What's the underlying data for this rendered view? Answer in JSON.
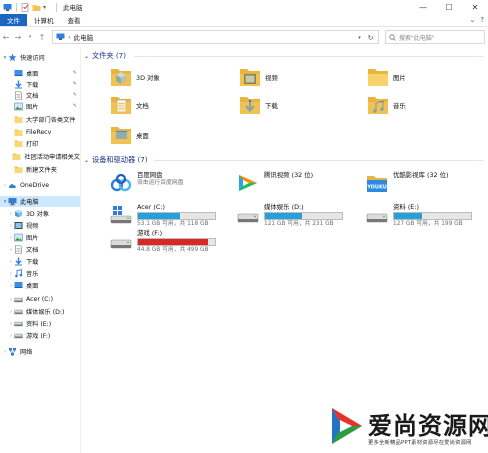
{
  "window": {
    "title": "此电脑",
    "controls": [
      "—",
      "☐",
      "✕"
    ]
  },
  "ribbon": {
    "tabs": [
      "文件",
      "计算机",
      "查看"
    ]
  },
  "address": {
    "crumb": "此电脑",
    "search_placeholder": "搜索\"此电脑\""
  },
  "sidebar": {
    "items": [
      {
        "label": "快速访问",
        "icon": "star-icon",
        "level": 0,
        "caret": "▾"
      },
      {
        "label": "桌面",
        "icon": "desktop-icon",
        "level": 1,
        "pin": true
      },
      {
        "label": "下载",
        "icon": "download-icon",
        "level": 1,
        "pin": true
      },
      {
        "label": "文档",
        "icon": "document-icon",
        "level": 1,
        "pin": true
      },
      {
        "label": "图片",
        "icon": "picture-icon",
        "level": 1,
        "pin": true
      },
      {
        "label": "大学部门各类文件",
        "icon": "folder-icon",
        "level": 1
      },
      {
        "label": "FileRecv",
        "icon": "folder-icon",
        "level": 1
      },
      {
        "label": "打印",
        "icon": "folder-icon",
        "level": 1
      },
      {
        "label": "社团活动申请相关文",
        "icon": "folder-icon",
        "level": 1
      },
      {
        "label": "新建文件夹",
        "icon": "folder-icon",
        "level": 1
      },
      {
        "label": "OneDrive",
        "icon": "cloud-icon",
        "level": 0,
        "caret": "›"
      },
      {
        "label": "此电脑",
        "icon": "computer-icon",
        "level": 0,
        "caret": "▾",
        "selected": true
      },
      {
        "label": "3D 对象",
        "icon": "cube-icon",
        "level": 1,
        "caret": "›"
      },
      {
        "label": "视频",
        "icon": "video-icon",
        "level": 1,
        "caret": "›"
      },
      {
        "label": "图片",
        "icon": "picture-icon",
        "level": 1,
        "caret": "›"
      },
      {
        "label": "文档",
        "icon": "document-icon",
        "level": 1,
        "caret": "›"
      },
      {
        "label": "下载",
        "icon": "download-icon",
        "level": 1,
        "caret": "›"
      },
      {
        "label": "音乐",
        "icon": "music-icon",
        "level": 1,
        "caret": "›"
      },
      {
        "label": "桌面",
        "icon": "desktop-icon",
        "level": 1,
        "caret": "›"
      },
      {
        "label": "Acer (C:)",
        "icon": "drive-icon",
        "level": 1,
        "caret": "›"
      },
      {
        "label": "媒体娱乐 (D:)",
        "icon": "drive-icon",
        "level": 1,
        "caret": "›"
      },
      {
        "label": "资料 (E:)",
        "icon": "drive-icon",
        "level": 1,
        "caret": "›"
      },
      {
        "label": "游戏 (F:)",
        "icon": "drive-icon",
        "level": 1,
        "caret": "›"
      },
      {
        "label": "网络",
        "icon": "network-icon",
        "level": 0,
        "caret": "›"
      }
    ]
  },
  "folders_group": {
    "title": "文件夹 (7)",
    "items": [
      {
        "label": "3D 对象",
        "icon": "cube-folder-icon"
      },
      {
        "label": "视频",
        "icon": "video-folder-icon"
      },
      {
        "label": "图片",
        "icon": "picture-folder-icon"
      },
      {
        "label": "文档",
        "icon": "document-folder-icon"
      },
      {
        "label": "下载",
        "icon": "download-folder-icon"
      },
      {
        "label": "音乐",
        "icon": "music-folder-icon"
      },
      {
        "label": "桌面",
        "icon": "desktop-folder-icon"
      }
    ]
  },
  "devices_group": {
    "title": "设备和驱动器 (7)",
    "apps": [
      {
        "name": "百度网盘",
        "sub": "双击运行百度网盘",
        "icon": "baidu-netdisk-icon"
      },
      {
        "name": "腾讯视频 (32 位)",
        "sub": "",
        "icon": "tencent-video-icon"
      },
      {
        "name": "优酷影视库 (32 位)",
        "sub": "",
        "icon": "youku-icon"
      }
    ],
    "drives": [
      {
        "name": "Acer (C:)",
        "size": "53.1 GB 可用，共 118 GB",
        "used": 0.55,
        "full": false,
        "icon": "windows-drive-icon"
      },
      {
        "name": "媒体娱乐 (D:)",
        "size": "121 GB 可用，共 231 GB",
        "used": 0.48,
        "full": false,
        "icon": "drive-icon"
      },
      {
        "name": "资料 (E:)",
        "size": "127 GB 可用，共 199 GB",
        "used": 0.36,
        "full": false,
        "icon": "drive-icon"
      },
      {
        "name": "游戏 (F:)",
        "size": "44.8 GB 可用，共 499 GB",
        "used": 0.91,
        "full": true,
        "icon": "drive-icon"
      }
    ]
  },
  "watermark": {
    "title": "爱尚资源网",
    "sub": "更多全新精品PPT素材资源尽在爱尚资源网"
  },
  "colors": {
    "accent": "#1a66c0",
    "group_header": "#1e3287",
    "selection": "#cce8ff",
    "bar_normal": "#26a0da",
    "bar_full": "#da2626",
    "folder_yellow": "#f4c553"
  }
}
